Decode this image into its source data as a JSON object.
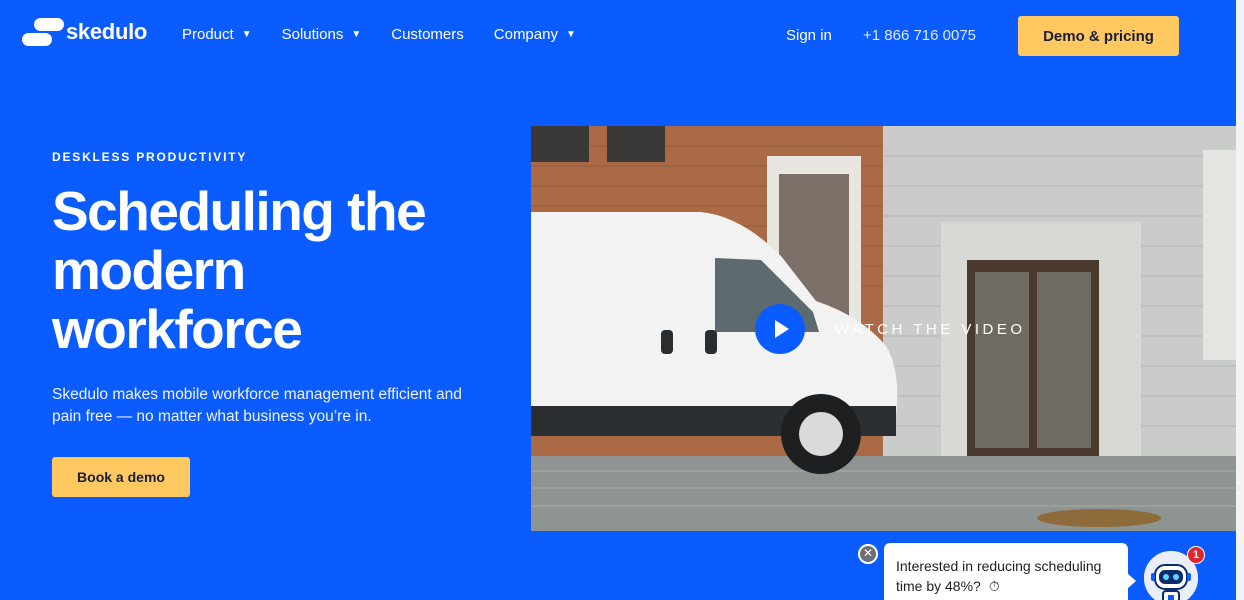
{
  "brand": {
    "name": "skedulo"
  },
  "nav": {
    "items": [
      {
        "label": "Product",
        "has_caret": true
      },
      {
        "label": "Solutions",
        "has_caret": true
      },
      {
        "label": "Customers",
        "has_caret": false
      },
      {
        "label": "Company",
        "has_caret": true
      }
    ],
    "signin": "Sign in",
    "phone": "+1 866 716 0075",
    "demo_button": "Demo & pricing"
  },
  "hero": {
    "eyebrow": "DESKLESS PRODUCTIVITY",
    "headline": "Scheduling the modern workforce",
    "description": "Skedulo makes mobile workforce management efficient and pain free — no matter what business you’re in.",
    "cta": "Book a demo"
  },
  "video": {
    "watch_label": "WATCH THE VIDEO",
    "icon": "play-icon"
  },
  "chat": {
    "message": "Interested in reducing scheduling time by 48%?",
    "emoji": "⏱",
    "badge_count": "1",
    "close_glyph": "✕"
  },
  "colors": {
    "background": "#0b5cff",
    "button": "#ffc861",
    "button_text": "#1a1f36",
    "badge": "#e0252c"
  }
}
